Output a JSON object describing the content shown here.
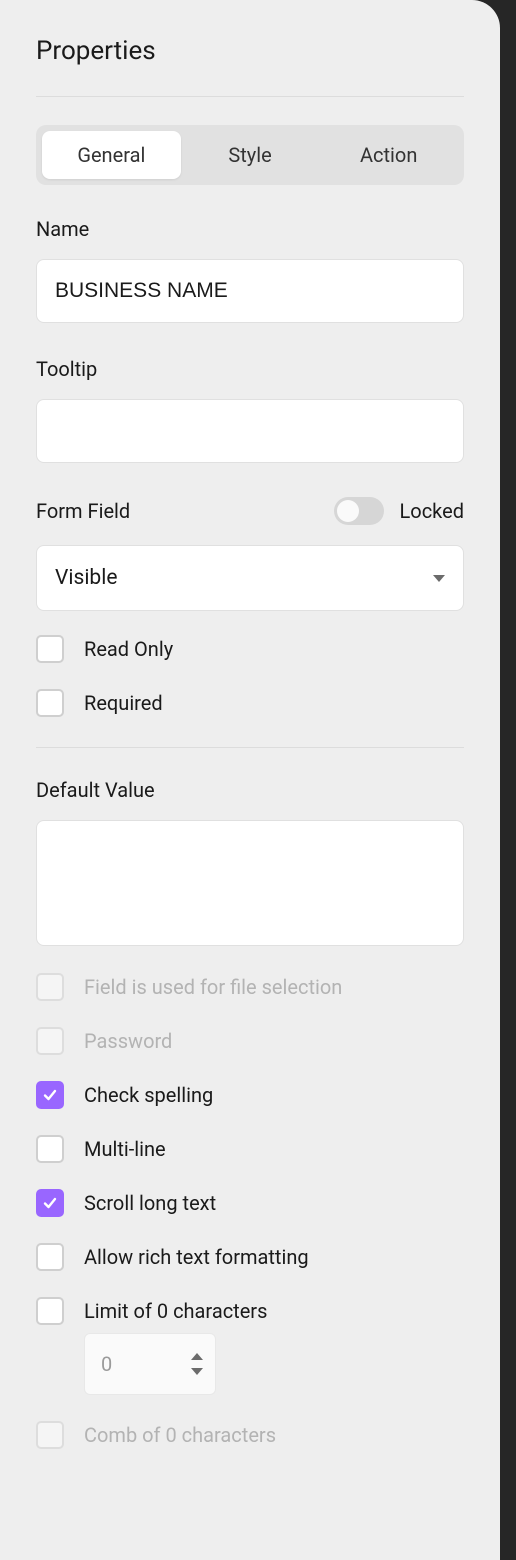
{
  "panel": {
    "title": "Properties"
  },
  "tabs": {
    "items": [
      {
        "label": "General",
        "active": true
      },
      {
        "label": "Style",
        "active": false
      },
      {
        "label": "Action",
        "active": false
      }
    ]
  },
  "name": {
    "label": "Name",
    "value": "BUSINESS NAME"
  },
  "tooltip": {
    "label": "Tooltip",
    "value": ""
  },
  "formField": {
    "label": "Form Field",
    "lockedLabel": "Locked",
    "locked": false,
    "visibility": "Visible"
  },
  "readOnly": {
    "label": "Read Only",
    "checked": false
  },
  "required": {
    "label": "Required",
    "checked": false
  },
  "defaultValue": {
    "label": "Default Value",
    "value": ""
  },
  "options": {
    "fileSelection": {
      "label": "Field is used for file selection",
      "checked": false,
      "disabled": true
    },
    "password": {
      "label": "Password",
      "checked": false,
      "disabled": true
    },
    "checkSpelling": {
      "label": "Check spelling",
      "checked": true,
      "disabled": false
    },
    "multiLine": {
      "label": "Multi-line",
      "checked": false,
      "disabled": false
    },
    "scrollLongText": {
      "label": "Scroll long text",
      "checked": true,
      "disabled": false
    },
    "richText": {
      "label": "Allow rich text formatting",
      "checked": false,
      "disabled": false
    },
    "limitChars": {
      "label": "Limit of 0 characters",
      "checked": false,
      "disabled": false,
      "value": "0"
    },
    "combChars": {
      "label": "Comb of 0 characters",
      "checked": false,
      "disabled": true
    }
  },
  "colors": {
    "accent": "#9966ff"
  }
}
